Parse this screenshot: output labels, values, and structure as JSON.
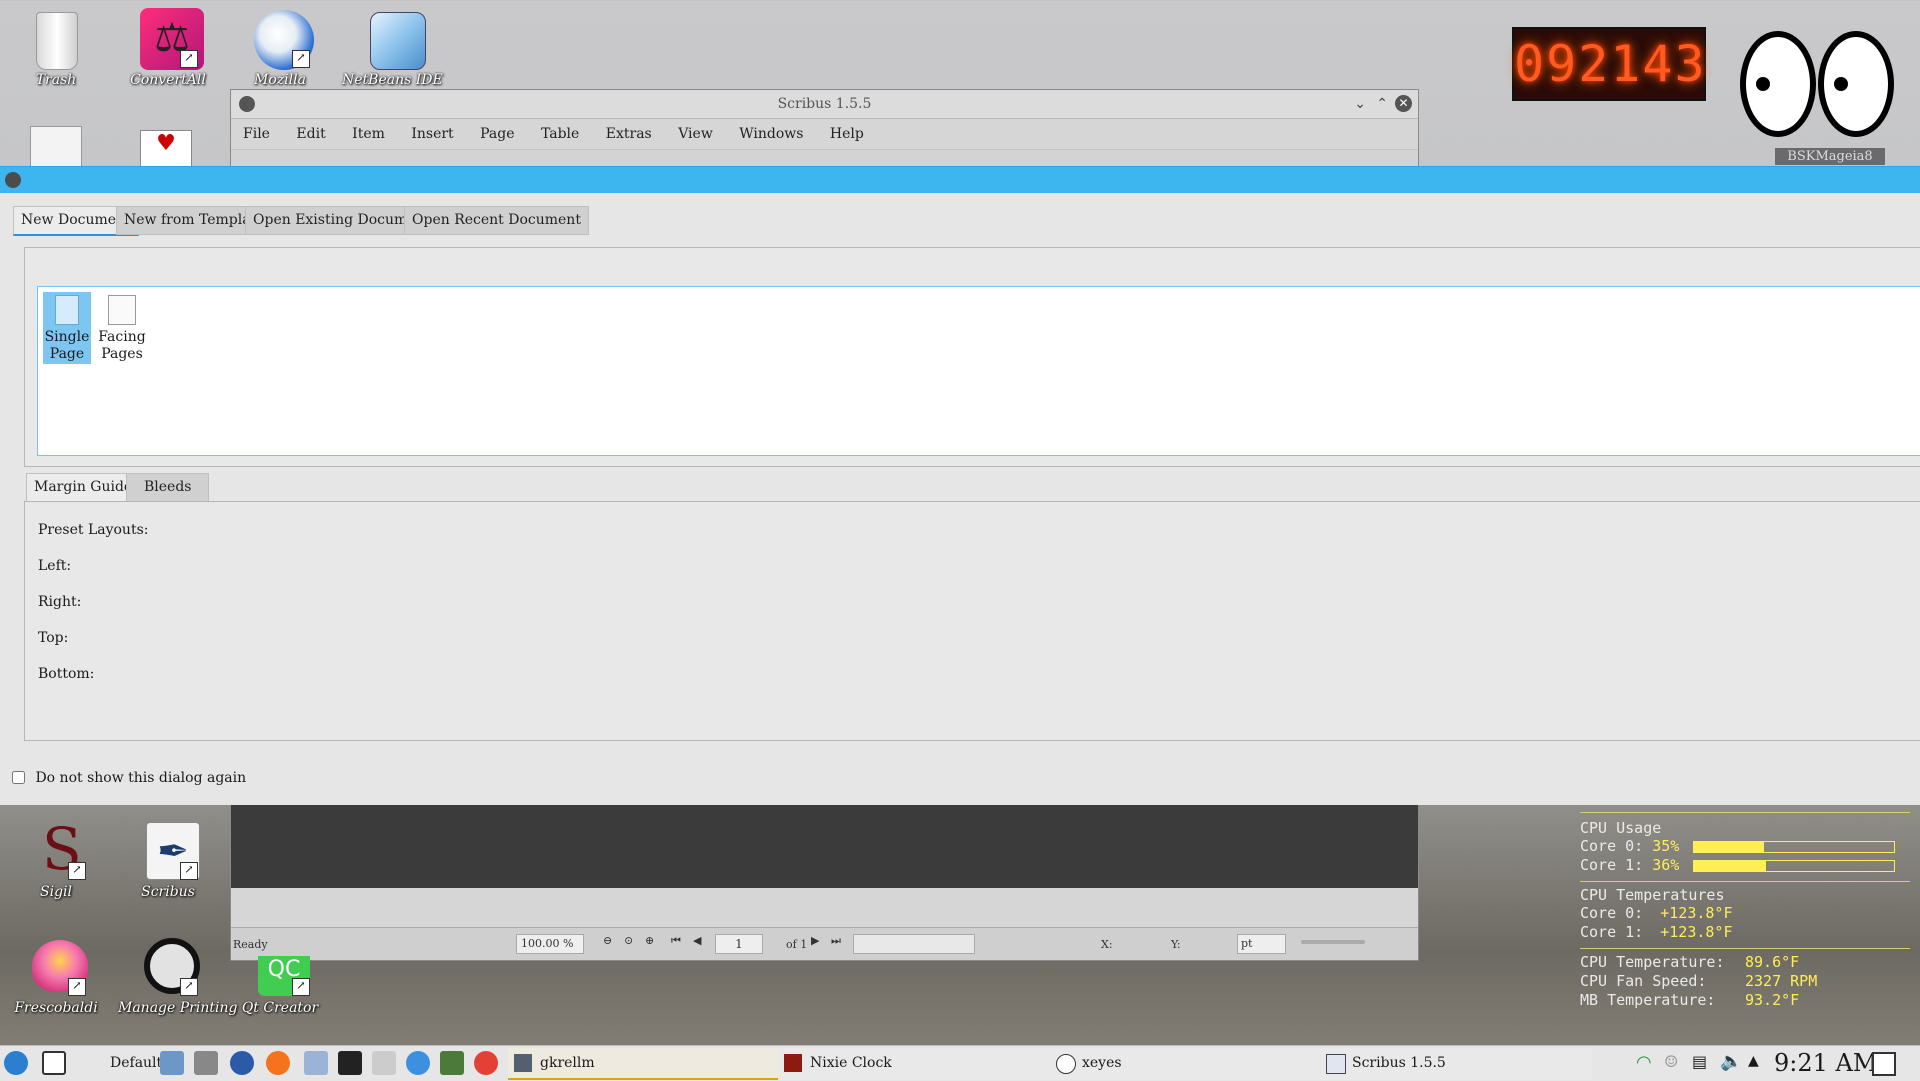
{
  "desktop": {
    "icons": [
      {
        "label": "Trash"
      },
      {
        "label": "ConvertAll"
      },
      {
        "label": "Mozilla"
      },
      {
        "label": "NetBeans IDE"
      },
      {
        "label": "Sigil"
      },
      {
        "label": "Scribus"
      },
      {
        "label": "Frescobaldi"
      },
      {
        "label": "Manage Printing"
      },
      {
        "label": "Qt Creator"
      }
    ],
    "nixie_time": "092143",
    "hostname_badge": "BSKMageia8"
  },
  "scribus": {
    "title": "Scribus 1.5.5",
    "menu": [
      "File",
      "Edit",
      "Item",
      "Insert",
      "Page",
      "Table",
      "Extras",
      "View",
      "Windows",
      "Help"
    ],
    "status": {
      "state": "Ready",
      "zoom": "100.00 %",
      "page": "1",
      "of_pages": "of 1",
      "x_label": "X:",
      "y_label": "Y:",
      "unit": "pt"
    }
  },
  "dialog": {
    "tabs": [
      "New Document",
      "New from Template",
      "Open Existing Document",
      "Open Recent Document"
    ],
    "layouts": [
      {
        "label": "Single Page",
        "selected": true
      },
      {
        "label": "Facing Pages",
        "selected": false
      }
    ],
    "subtabs": [
      "Margin Guides",
      "Bleeds"
    ],
    "fields": [
      "Preset Layouts:",
      "Left:",
      "Right:",
      "Top:",
      "Bottom:"
    ],
    "checkbox_label": "Do not show this dialog again",
    "checkbox_checked": false
  },
  "monitor": {
    "cpu_usage_title": "CPU Usage",
    "cores": [
      {
        "label": "Core 0:",
        "value": "35%",
        "level": 0.35
      },
      {
        "label": "Core 1:",
        "value": "36%",
        "level": 0.36
      }
    ],
    "temps_title": "CPU Temperatures",
    "core_temps": [
      {
        "label": "Core 0:",
        "value": "+123.8°F"
      },
      {
        "label": "Core 1:",
        "value": "+123.8°F"
      }
    ],
    "cpu_temp_label": "CPU Temperature:",
    "cpu_temp_value": "89.6°F",
    "fan_label": "CPU Fan Speed:",
    "fan_value": "2327 RPM",
    "mb_label": "MB Temperature:",
    "mb_value": "93.2°F"
  },
  "taskbar": {
    "workspace": "Default",
    "apps": [
      {
        "label": "gkrellm"
      },
      {
        "label": "Nixie Clock"
      },
      {
        "label": "xeyes"
      },
      {
        "label": "Scribus 1.5.5"
      }
    ],
    "clock": "9:21 AM"
  }
}
